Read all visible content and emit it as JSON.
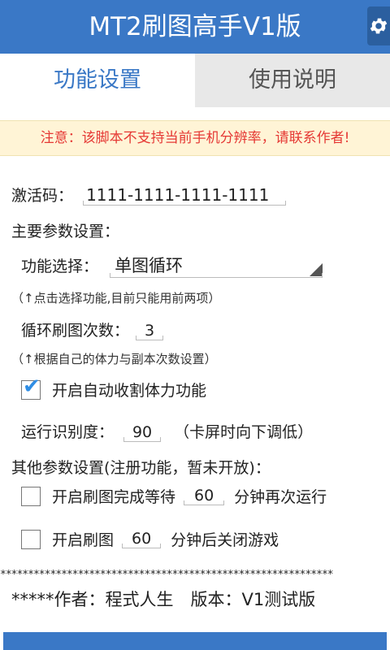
{
  "app": {
    "title": "MT2刷图高手V1版",
    "accent": "#3a78c6",
    "settings_icon": "gear-icon"
  },
  "tabs": [
    {
      "label": "功能设置",
      "active": true
    },
    {
      "label": "使用说明",
      "active": false
    }
  ],
  "warning": "注意：该脚本不支持当前手机分辨率，请联系作者!",
  "activation": {
    "label": "激活码：",
    "value": "1111-1111-1111-1111"
  },
  "main_section": "主要参数设置：",
  "function": {
    "label": "功能选择：",
    "value": "单图循环",
    "hint": "（↑点击选择功能,目前只能用前两项）"
  },
  "loop": {
    "label": "循环刷图次数：",
    "value": "3",
    "hint": "（↑根据自己的体力与副本次数设置）"
  },
  "auto_stamina": {
    "label": "开启自动收割体力功能",
    "checked": true
  },
  "recognition": {
    "label": "运行识别度：",
    "value": "90",
    "hint": "（卡屏时向下调低）"
  },
  "other_section": "其他参数设置(注册功能，暂未开放)：",
  "wait_option": {
    "label_a": "开启刷图完成等待",
    "value": "60",
    "label_b": "分钟再次运行",
    "checked": false
  },
  "close_option": {
    "label_a": "开启刷图",
    "value": "60",
    "label_b": "分钟后关闭游戏",
    "checked": false
  },
  "divider": "************************************************************",
  "footer": "*****作者：程式人生　版本：V1测试版"
}
